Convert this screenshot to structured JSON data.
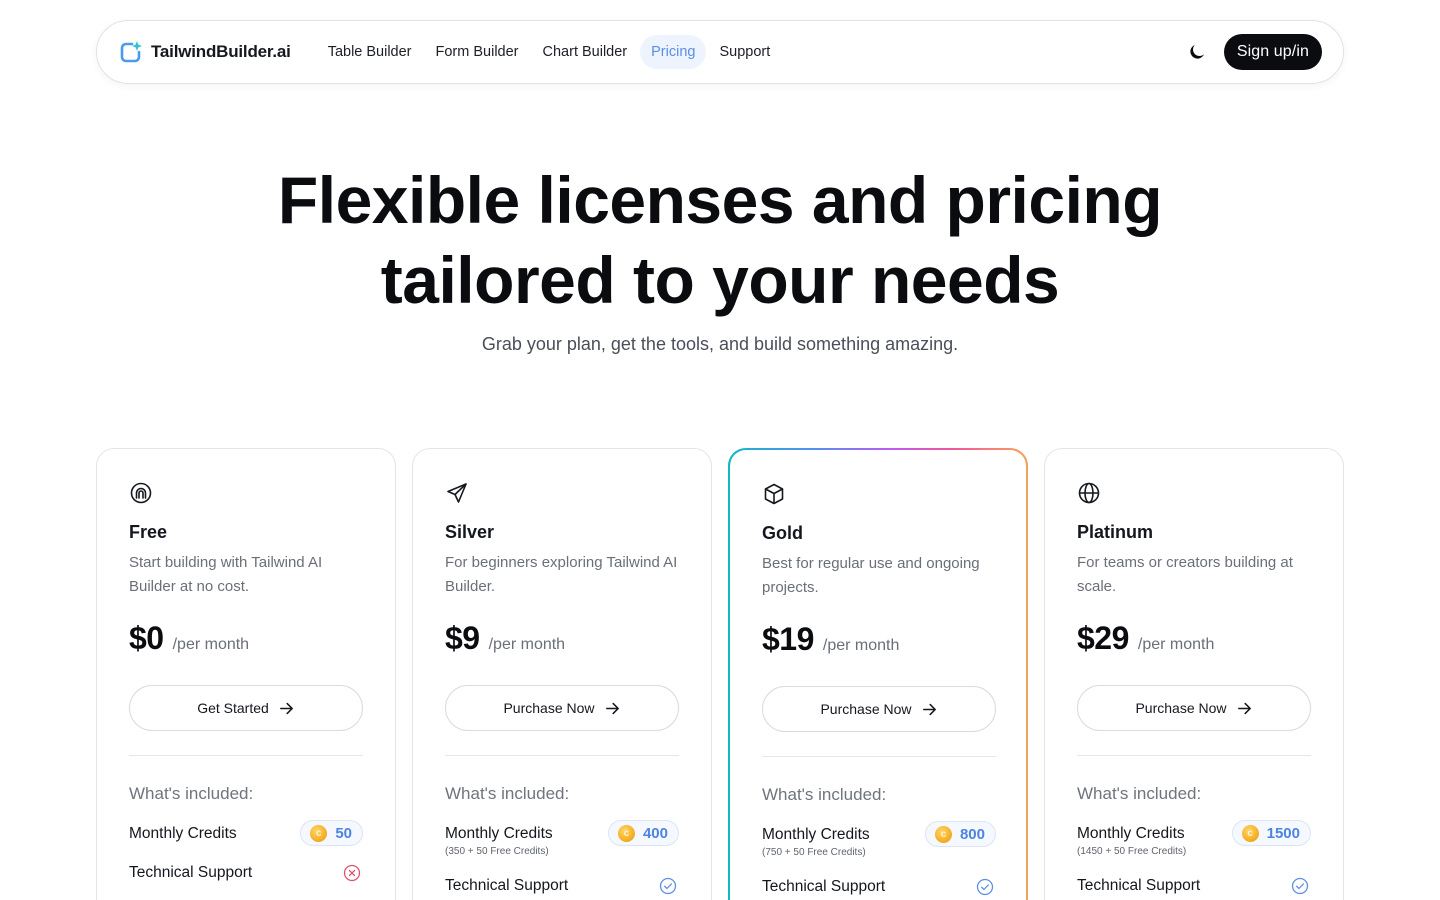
{
  "nav": {
    "brand_bold": "TailwindBuilder",
    "brand_thin": ".ai",
    "links": [
      {
        "label": "Table Builder",
        "active": false
      },
      {
        "label": "Form Builder",
        "active": false
      },
      {
        "label": "Chart Builder",
        "active": false
      },
      {
        "label": "Pricing",
        "active": true
      },
      {
        "label": "Support",
        "active": false
      }
    ],
    "theme_toggle_icon": "moon-icon",
    "signup_label": "Sign up/in"
  },
  "hero": {
    "title_line1": "Flexible licenses and pricing",
    "title_line2": "tailored to your needs",
    "subtitle": "Grab your plan, get the tools, and build something amazing."
  },
  "plans": [
    {
      "icon": "fingerprint-icon",
      "name": "Free",
      "description": "Start building with Tailwind AI Builder at no cost.",
      "price": "$0",
      "period": "/per month",
      "cta": "Get Started",
      "included_label": "What's included:",
      "credits_label": "Monthly Credits",
      "credits_note": "",
      "credits": "50",
      "support_label": "Technical Support",
      "support_included": false
    },
    {
      "icon": "paper-plane-icon",
      "name": "Silver",
      "description": "For beginners exploring Tailwind AI Builder.",
      "price": "$9",
      "period": "/per month",
      "cta": "Purchase Now",
      "included_label": "What's included:",
      "credits_label": "Monthly Credits",
      "credits_note": "(350 + 50 Free Credits)",
      "credits": "400",
      "support_label": "Technical Support",
      "support_included": true
    },
    {
      "icon": "cube-icon",
      "name": "Gold",
      "description": "Best for regular use and ongoing projects.",
      "price": "$19",
      "period": "/per month",
      "cta": "Purchase Now",
      "included_label": "What's included:",
      "credits_label": "Monthly Credits",
      "credits_note": "(750 + 50 Free Credits)",
      "credits": "800",
      "support_label": "Technical Support",
      "support_included": true
    },
    {
      "icon": "globe-icon",
      "name": "Platinum",
      "description": "For teams or creators building at scale.",
      "price": "$29",
      "period": "/per month",
      "cta": "Purchase Now",
      "included_label": "What's included:",
      "credits_label": "Monthly Credits",
      "credits_note": "(1450 + 50 Free Credits)",
      "credits": "1500",
      "support_label": "Technical Support",
      "support_included": true
    }
  ],
  "colors": {
    "accent": "#5b8ee6",
    "check": "#5b8ee6",
    "cross": "#e0506a",
    "coin": "#f7b32b"
  }
}
